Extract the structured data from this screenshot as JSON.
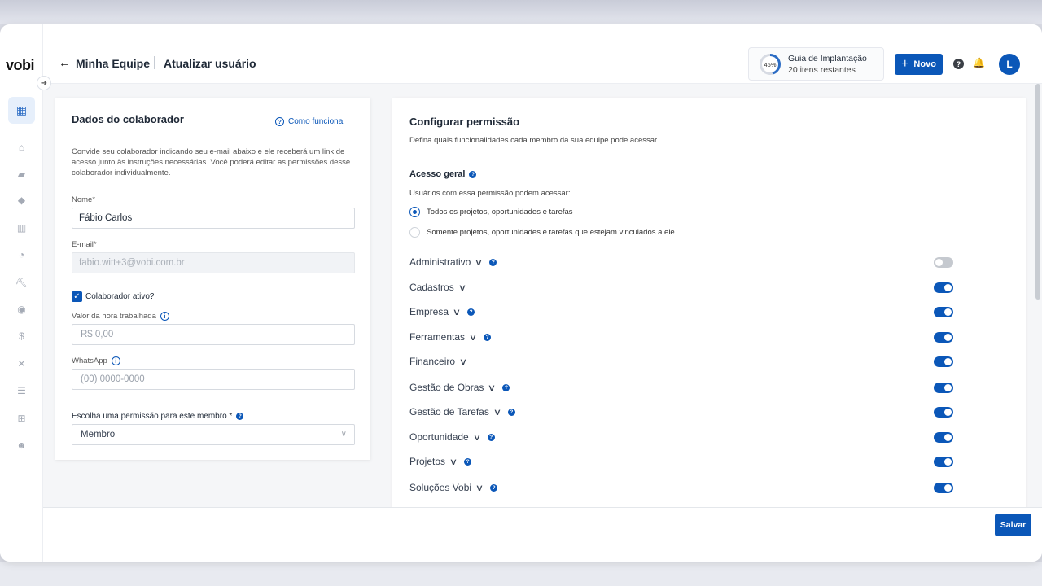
{
  "app": {
    "logo": "vobi"
  },
  "header": {
    "crumb_parent": "Minha Equipe",
    "crumb_current": "Atualizar usuário",
    "guide": {
      "percent": "46%",
      "title": "Guia de Implantação",
      "subtitle": "20 itens restantes",
      "progress": 0.46
    },
    "new_button": "Novo",
    "avatar_initial": "L"
  },
  "left_card": {
    "title": "Dados do colaborador",
    "how_link": "Como funciona",
    "description": "Convide seu colaborador indicando seu e-mail abaixo e ele receberá um link de acesso junto às instruções necessárias. Você poderá editar as permissões desse colaborador individualmente.",
    "name_label": "Nome*",
    "name_value": "Fábio Carlos",
    "email_label": "E-mail*",
    "email_value": "fabio.witt+3@vobi.com.br",
    "active_label": "Colaborador ativo?",
    "active_checked": true,
    "hour_label": "Valor da hora trabalhada",
    "hour_placeholder": "R$ 0,00",
    "whatsapp_label": "WhatsApp",
    "whatsapp_placeholder": "(00) 0000-0000",
    "permission_label": "Escolha uma permissão para este membro *",
    "permission_value": "Membro"
  },
  "right_card": {
    "title": "Configurar permissão",
    "description": "Defina quais funcionalidades cada membro da sua equipe pode acessar.",
    "general_title": "Acesso geral",
    "users_text": "Usuários com essa permissão podem acessar:",
    "radio_options": [
      {
        "label": "Todos os projetos, oportunidades e tarefas",
        "selected": true
      },
      {
        "label": "Somente projetos, oportunidades e tarefas que estejam vinculados a ele",
        "selected": false
      }
    ],
    "permissions": [
      {
        "name": "Administrativo",
        "info": true,
        "enabled": false
      },
      {
        "name": "Cadastros",
        "info": false,
        "enabled": true
      },
      {
        "name": "Empresa",
        "info": true,
        "enabled": true
      },
      {
        "name": "Ferramentas",
        "info": true,
        "enabled": true
      },
      {
        "name": "Financeiro",
        "info": false,
        "enabled": true
      },
      {
        "name": "Gestão de Obras",
        "info": true,
        "enabled": true
      },
      {
        "name": "Gestão de Tarefas",
        "info": true,
        "enabled": true
      },
      {
        "name": "Oportunidade",
        "info": true,
        "enabled": true
      },
      {
        "name": "Projetos",
        "info": true,
        "enabled": true
      },
      {
        "name": "Soluções Vobi",
        "info": true,
        "enabled": true
      }
    ]
  },
  "footer": {
    "save_button": "Salvar"
  },
  "icons": {
    "sidebar": [
      "dashboard-icon",
      "home-icon",
      "folder-icon",
      "handshake-icon",
      "building-icon",
      "gauge-icon",
      "worker-icon",
      "coins-icon",
      "dollar-icon",
      "tools-icon",
      "list-icon",
      "apps-icon",
      "team-icon"
    ]
  },
  "colors": {
    "primary": "#0b57b8",
    "toggle_off": "#c5c9cf"
  }
}
